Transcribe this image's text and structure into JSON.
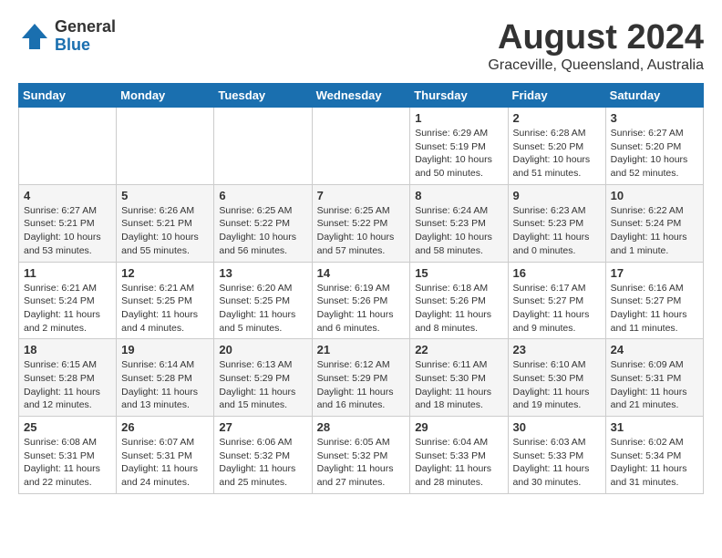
{
  "header": {
    "logo_general": "General",
    "logo_blue": "Blue",
    "month": "August 2024",
    "location": "Graceville, Queensland, Australia"
  },
  "weekdays": [
    "Sunday",
    "Monday",
    "Tuesday",
    "Wednesday",
    "Thursday",
    "Friday",
    "Saturday"
  ],
  "weeks": [
    [
      {
        "day": "",
        "detail": ""
      },
      {
        "day": "",
        "detail": ""
      },
      {
        "day": "",
        "detail": ""
      },
      {
        "day": "",
        "detail": ""
      },
      {
        "day": "1",
        "detail": "Sunrise: 6:29 AM\nSunset: 5:19 PM\nDaylight: 10 hours and 50 minutes."
      },
      {
        "day": "2",
        "detail": "Sunrise: 6:28 AM\nSunset: 5:20 PM\nDaylight: 10 hours and 51 minutes."
      },
      {
        "day": "3",
        "detail": "Sunrise: 6:27 AM\nSunset: 5:20 PM\nDaylight: 10 hours and 52 minutes."
      }
    ],
    [
      {
        "day": "4",
        "detail": "Sunrise: 6:27 AM\nSunset: 5:21 PM\nDaylight: 10 hours and 53 minutes."
      },
      {
        "day": "5",
        "detail": "Sunrise: 6:26 AM\nSunset: 5:21 PM\nDaylight: 10 hours and 55 minutes."
      },
      {
        "day": "6",
        "detail": "Sunrise: 6:25 AM\nSunset: 5:22 PM\nDaylight: 10 hours and 56 minutes."
      },
      {
        "day": "7",
        "detail": "Sunrise: 6:25 AM\nSunset: 5:22 PM\nDaylight: 10 hours and 57 minutes."
      },
      {
        "day": "8",
        "detail": "Sunrise: 6:24 AM\nSunset: 5:23 PM\nDaylight: 10 hours and 58 minutes."
      },
      {
        "day": "9",
        "detail": "Sunrise: 6:23 AM\nSunset: 5:23 PM\nDaylight: 11 hours and 0 minutes."
      },
      {
        "day": "10",
        "detail": "Sunrise: 6:22 AM\nSunset: 5:24 PM\nDaylight: 11 hours and 1 minute."
      }
    ],
    [
      {
        "day": "11",
        "detail": "Sunrise: 6:21 AM\nSunset: 5:24 PM\nDaylight: 11 hours and 2 minutes."
      },
      {
        "day": "12",
        "detail": "Sunrise: 6:21 AM\nSunset: 5:25 PM\nDaylight: 11 hours and 4 minutes."
      },
      {
        "day": "13",
        "detail": "Sunrise: 6:20 AM\nSunset: 5:25 PM\nDaylight: 11 hours and 5 minutes."
      },
      {
        "day": "14",
        "detail": "Sunrise: 6:19 AM\nSunset: 5:26 PM\nDaylight: 11 hours and 6 minutes."
      },
      {
        "day": "15",
        "detail": "Sunrise: 6:18 AM\nSunset: 5:26 PM\nDaylight: 11 hours and 8 minutes."
      },
      {
        "day": "16",
        "detail": "Sunrise: 6:17 AM\nSunset: 5:27 PM\nDaylight: 11 hours and 9 minutes."
      },
      {
        "day": "17",
        "detail": "Sunrise: 6:16 AM\nSunset: 5:27 PM\nDaylight: 11 hours and 11 minutes."
      }
    ],
    [
      {
        "day": "18",
        "detail": "Sunrise: 6:15 AM\nSunset: 5:28 PM\nDaylight: 11 hours and 12 minutes."
      },
      {
        "day": "19",
        "detail": "Sunrise: 6:14 AM\nSunset: 5:28 PM\nDaylight: 11 hours and 13 minutes."
      },
      {
        "day": "20",
        "detail": "Sunrise: 6:13 AM\nSunset: 5:29 PM\nDaylight: 11 hours and 15 minutes."
      },
      {
        "day": "21",
        "detail": "Sunrise: 6:12 AM\nSunset: 5:29 PM\nDaylight: 11 hours and 16 minutes."
      },
      {
        "day": "22",
        "detail": "Sunrise: 6:11 AM\nSunset: 5:30 PM\nDaylight: 11 hours and 18 minutes."
      },
      {
        "day": "23",
        "detail": "Sunrise: 6:10 AM\nSunset: 5:30 PM\nDaylight: 11 hours and 19 minutes."
      },
      {
        "day": "24",
        "detail": "Sunrise: 6:09 AM\nSunset: 5:31 PM\nDaylight: 11 hours and 21 minutes."
      }
    ],
    [
      {
        "day": "25",
        "detail": "Sunrise: 6:08 AM\nSunset: 5:31 PM\nDaylight: 11 hours and 22 minutes."
      },
      {
        "day": "26",
        "detail": "Sunrise: 6:07 AM\nSunset: 5:31 PM\nDaylight: 11 hours and 24 minutes."
      },
      {
        "day": "27",
        "detail": "Sunrise: 6:06 AM\nSunset: 5:32 PM\nDaylight: 11 hours and 25 minutes."
      },
      {
        "day": "28",
        "detail": "Sunrise: 6:05 AM\nSunset: 5:32 PM\nDaylight: 11 hours and 27 minutes."
      },
      {
        "day": "29",
        "detail": "Sunrise: 6:04 AM\nSunset: 5:33 PM\nDaylight: 11 hours and 28 minutes."
      },
      {
        "day": "30",
        "detail": "Sunrise: 6:03 AM\nSunset: 5:33 PM\nDaylight: 11 hours and 30 minutes."
      },
      {
        "day": "31",
        "detail": "Sunrise: 6:02 AM\nSunset: 5:34 PM\nDaylight: 11 hours and 31 minutes."
      }
    ]
  ]
}
